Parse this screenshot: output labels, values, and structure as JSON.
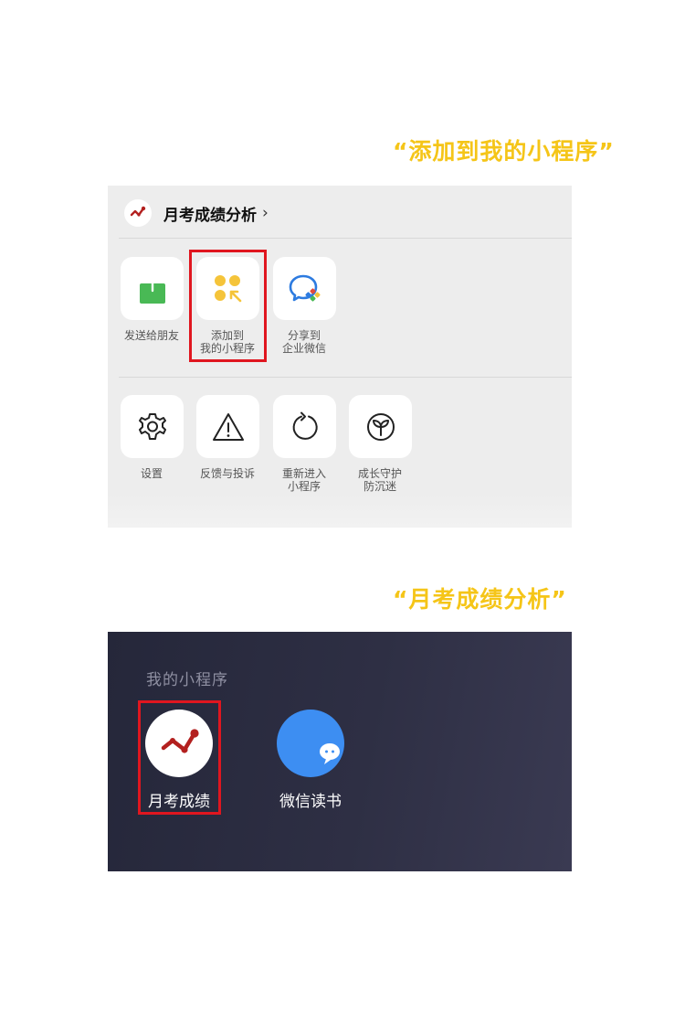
{
  "captions": {
    "add_mini_program": "“添加到我的小程序”",
    "yuekao_app": "“月考成绩分析”"
  },
  "share_sheet": {
    "app_title": "月考成绩分析",
    "row1": [
      {
        "label": "发送给朋友",
        "icon": "share-upload-icon"
      },
      {
        "label_line1": "添加到",
        "label_line2": "我的小程序",
        "icon": "add-mini-program-icon"
      },
      {
        "label_line1": "分享到",
        "label_line2": "企业微信",
        "icon": "wecom-icon"
      }
    ],
    "row2": [
      {
        "label": "设置",
        "icon": "gear-icon"
      },
      {
        "label": "反馈与投诉",
        "icon": "warning-icon"
      },
      {
        "label_line1": "重新进入",
        "label_line2": "小程序",
        "icon": "refresh-icon"
      },
      {
        "label_line1": "成长守护",
        "label_line2": "防沉迷",
        "icon": "sprout-icon"
      }
    ]
  },
  "desktop": {
    "heading": "我的小程序",
    "apps": [
      {
        "label": "月考成绩",
        "icon": "trend-line-icon"
      },
      {
        "label": "微信读书",
        "icon": "wechat-read-icon"
      }
    ]
  },
  "colors": {
    "caption": "#f5c518",
    "highlight": "#e0161f",
    "brand_red": "#b3201f",
    "green": "#49b955",
    "yellow": "#f5c43a"
  }
}
